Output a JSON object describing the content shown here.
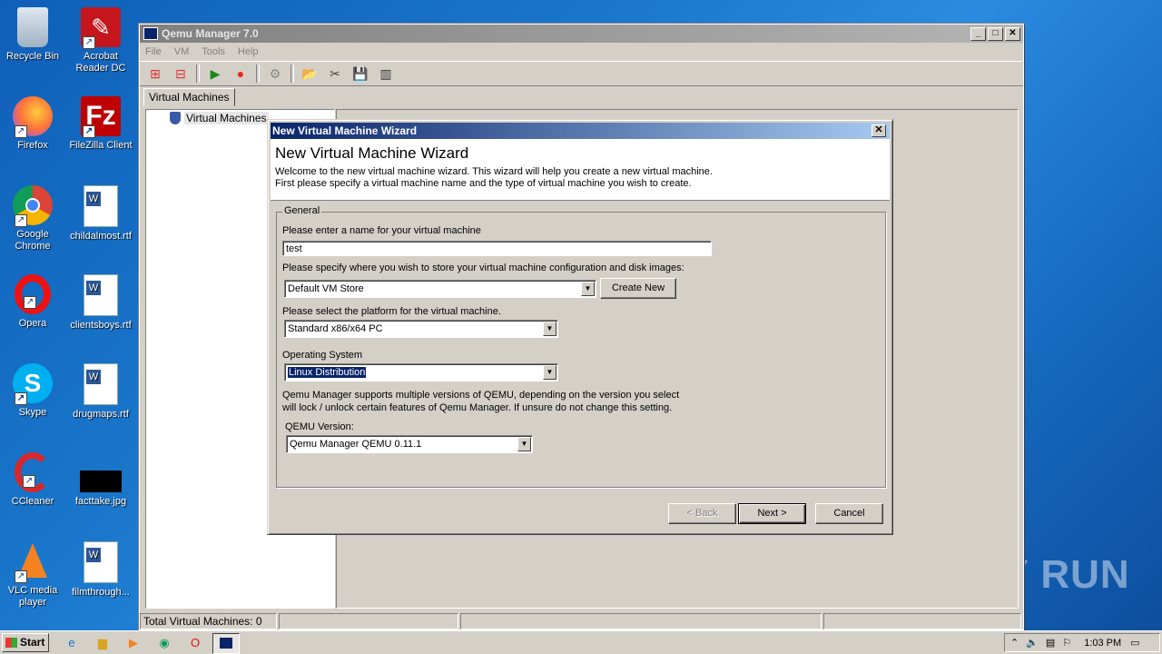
{
  "desktop": {
    "icons": [
      {
        "label": "Recycle Bin",
        "icon": "recycle-bin-icon"
      },
      {
        "label": "Acrobat Reader DC",
        "icon": "acrobat-icon"
      },
      {
        "label": "Firefox",
        "icon": "firefox-icon"
      },
      {
        "label": "FileZilla Client",
        "icon": "filezilla-icon"
      },
      {
        "label": "Google Chrome",
        "icon": "chrome-icon"
      },
      {
        "label": "childalmost.rtf",
        "icon": "rtf-document-icon"
      },
      {
        "label": "Opera",
        "icon": "opera-icon"
      },
      {
        "label": "clientsboys.rtf",
        "icon": "rtf-document-icon"
      },
      {
        "label": "Skype",
        "icon": "skype-icon"
      },
      {
        "label": "drugmaps.rtf",
        "icon": "rtf-document-icon"
      },
      {
        "label": "CCleaner",
        "icon": "ccleaner-icon"
      },
      {
        "label": "facttake.jpg",
        "icon": "jpg-image-icon"
      },
      {
        "label": "VLC media player",
        "icon": "vlc-icon"
      },
      {
        "label": "filmthrough...",
        "icon": "rtf-document-icon"
      }
    ]
  },
  "window": {
    "title": "Qemu Manager 7.0",
    "menu": [
      "File",
      "VM",
      "Tools",
      "Help"
    ],
    "tab": "Virtual Machines",
    "tree_root": "Virtual Machines",
    "status": "Total Virtual Machines: 0"
  },
  "wizard": {
    "title": "New Virtual Machine Wizard",
    "heading": "New Virtual Machine Wizard",
    "intro_line1": "Welcome to the new virtual machine wizard.   This wizard will help you create a new virtual machine.",
    "intro_line2": "First please specify a virtual machine name and the type of virtual machine you wish to create.",
    "group_label": "General",
    "name_label": "Please enter a name for your virtual machine",
    "name_value": "test",
    "store_label": "Please specify where you wish to store your virtual machine configuration and disk images:",
    "store_value": "Default VM Store",
    "create_new": "Create New",
    "platform_label": "Please select the platform for the virtual machine.",
    "platform_value": "Standard x86/x64 PC",
    "os_label": "Operating System",
    "os_value": "Linux Distribution",
    "qemu_note_line1": "Qemu Manager supports multiple versions of QEMU, depending on the version you select",
    "qemu_note_line2": "will lock / unlock certain features of Qemu Manager. If unsure do not change this setting.",
    "qemu_version_label": "QEMU Version:",
    "qemu_version_value": "Qemu Manager QEMU 0.11.1",
    "back": "< Back",
    "next": "Next >",
    "cancel": "Cancel"
  },
  "taskbar": {
    "start": "Start",
    "clock": "1:03 PM"
  },
  "watermark": "ANY RUN"
}
